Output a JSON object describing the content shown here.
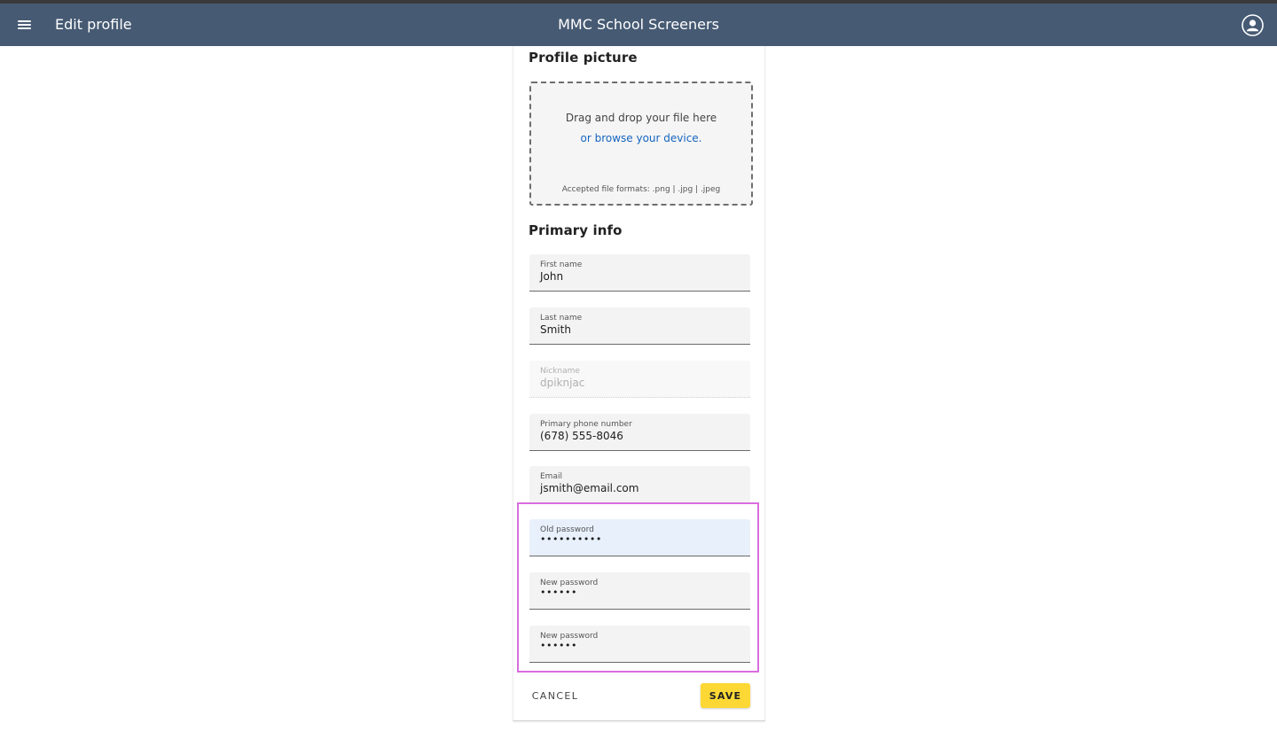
{
  "appbar": {
    "page_title": "Edit profile",
    "app_title": "MMC School Screeners",
    "background": "#465a73"
  },
  "profile_picture": {
    "section_title": "Profile picture",
    "drop_text": "Drag and drop your file here",
    "browse_link": "or browse your device.",
    "formats": "Accepted file formats: .png | .jpg | .jpeg"
  },
  "primary_info": {
    "section_title": "Primary info",
    "fields": [
      {
        "label": "First name",
        "value": "John",
        "state": "enabled"
      },
      {
        "label": "Last name",
        "value": "Smith",
        "state": "enabled"
      },
      {
        "label": "Nickname",
        "value": "dpiknjac",
        "state": "disabled"
      },
      {
        "label": "Primary phone number",
        "value": "(678) 555-8046",
        "state": "enabled"
      },
      {
        "label": "Email",
        "value": "jsmith@email.com",
        "state": "enabled"
      }
    ]
  },
  "password": {
    "fields": [
      {
        "label": "Old password",
        "value": "••••••••••",
        "state": "focused"
      },
      {
        "label": "New password",
        "value": "••••••",
        "state": "enabled"
      },
      {
        "label": "New password",
        "value": "••••••",
        "state": "enabled"
      }
    ],
    "highlight_color": "#d96cdf"
  },
  "actions": {
    "cancel_label": "CANCEL",
    "save_label": "SAVE",
    "save_color": "#fdd835"
  },
  "icons": {
    "menu": "hamburger-menu-icon",
    "account": "account-circle-icon"
  }
}
